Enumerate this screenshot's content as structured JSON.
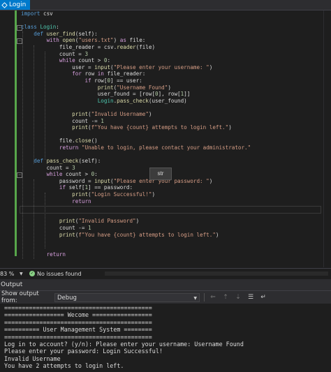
{
  "window": {
    "title": "Login"
  },
  "editor": {
    "tooltip": "str",
    "lines": [
      [
        [
          "import",
          "kw"
        ],
        [
          " csv",
          "id"
        ]
      ],
      [
        [
          "",
          ""
        ]
      ],
      [
        [
          "class",
          "kw"
        ],
        [
          " ",
          ""
        ],
        [
          "Login",
          "cls"
        ],
        [
          ":",
          "id"
        ]
      ],
      [
        [
          "    ",
          ""
        ],
        [
          "def",
          "kw"
        ],
        [
          " ",
          ""
        ],
        [
          "user_find",
          "fn"
        ],
        [
          "(self):",
          "id"
        ]
      ],
      [
        [
          "        ",
          ""
        ],
        [
          "with",
          "ctl"
        ],
        [
          " ",
          ""
        ],
        [
          "open",
          "fn"
        ],
        [
          "(",
          "id"
        ],
        [
          "\"users.txt\"",
          "str"
        ],
        [
          ") ",
          "id"
        ],
        [
          "as",
          "ctl"
        ],
        [
          " file:",
          "id"
        ]
      ],
      [
        [
          "            file_reader = csv.",
          ""
        ],
        [
          "reader",
          "fn"
        ],
        [
          "(file)",
          "id"
        ]
      ],
      [
        [
          "            count = ",
          ""
        ],
        [
          "3",
          "num"
        ]
      ],
      [
        [
          "            ",
          ""
        ],
        [
          "while",
          "ctl"
        ],
        [
          " count > ",
          ""
        ],
        [
          "0",
          "num"
        ],
        [
          ":",
          "id"
        ]
      ],
      [
        [
          "                user = ",
          ""
        ],
        [
          "input",
          "fn"
        ],
        [
          "(",
          "id"
        ],
        [
          "\"Please enter your username: \"",
          "str"
        ],
        [
          ")",
          "id"
        ]
      ],
      [
        [
          "                ",
          ""
        ],
        [
          "for",
          "ctl"
        ],
        [
          " row ",
          ""
        ],
        [
          "in",
          "ctl"
        ],
        [
          " file_reader:",
          "id"
        ]
      ],
      [
        [
          "                    ",
          ""
        ],
        [
          "if",
          "ctl"
        ],
        [
          " row[",
          ""
        ],
        [
          "0",
          "num"
        ],
        [
          "] == user:",
          "id"
        ]
      ],
      [
        [
          "                        ",
          ""
        ],
        [
          "print",
          "fn"
        ],
        [
          "(",
          "id"
        ],
        [
          "\"Username Found\"",
          "str"
        ],
        [
          ")",
          "id"
        ]
      ],
      [
        [
          "                        user_found = [row[",
          ""
        ],
        [
          "0",
          "num"
        ],
        [
          "], row[",
          "id"
        ],
        [
          "1",
          "num"
        ],
        [
          "]]",
          "id"
        ]
      ],
      [
        [
          "                        ",
          ""
        ],
        [
          "Login",
          "cls"
        ],
        [
          ".",
          "id"
        ],
        [
          "pass_check",
          "fn"
        ],
        [
          "(user_found)",
          "id"
        ]
      ],
      [
        [
          "",
          ""
        ]
      ],
      [
        [
          "                ",
          ""
        ],
        [
          "print",
          "fn"
        ],
        [
          "(",
          "id"
        ],
        [
          "\"Invalid Username\"",
          "str"
        ],
        [
          ")",
          "id"
        ]
      ],
      [
        [
          "                count -= ",
          ""
        ],
        [
          "1",
          "num"
        ]
      ],
      [
        [
          "                ",
          ""
        ],
        [
          "print",
          "fn"
        ],
        [
          "(",
          "id"
        ],
        [
          "f\"You have {count} attempts to login left.\"",
          "str"
        ],
        [
          ")",
          "id"
        ]
      ],
      [
        [
          "",
          ""
        ]
      ],
      [
        [
          "            file.",
          ""
        ],
        [
          "close",
          "fn"
        ],
        [
          "()",
          "id"
        ]
      ],
      [
        [
          "            ",
          ""
        ],
        [
          "return",
          "ctl"
        ],
        [
          " ",
          ""
        ],
        [
          "\"Unable to login, please contact your administrator.\"",
          "str"
        ]
      ],
      [
        [
          "",
          ""
        ]
      ],
      [
        [
          "    ",
          ""
        ],
        [
          "def",
          "kw"
        ],
        [
          " ",
          ""
        ],
        [
          "pass_check",
          "fn"
        ],
        [
          "(self):",
          "id"
        ]
      ],
      [
        [
          "        count = ",
          ""
        ],
        [
          "3",
          "num"
        ]
      ],
      [
        [
          "        ",
          ""
        ],
        [
          "while",
          "ctl"
        ],
        [
          " count > ",
          ""
        ],
        [
          "0",
          "num"
        ],
        [
          ":",
          "id"
        ]
      ],
      [
        [
          "            password = ",
          ""
        ],
        [
          "input",
          "fn"
        ],
        [
          "(",
          "id"
        ],
        [
          "\"Please enter your password: \"",
          "str"
        ],
        [
          ")",
          "id"
        ]
      ],
      [
        [
          "            ",
          ""
        ],
        [
          "if",
          "ctl"
        ],
        [
          " self[",
          ""
        ],
        [
          "1",
          "num"
        ],
        [
          "] == password:",
          "id"
        ]
      ],
      [
        [
          "                ",
          ""
        ],
        [
          "print",
          "fn"
        ],
        [
          "(",
          "id"
        ],
        [
          "\"Login Successful!\"",
          "str"
        ],
        [
          ")",
          "id"
        ]
      ],
      [
        [
          "                ",
          ""
        ],
        [
          "return",
          "ctl"
        ]
      ],
      [
        [
          "",
          ""
        ]
      ],
      [
        [
          "",
          ""
        ]
      ],
      [
        [
          "            ",
          ""
        ],
        [
          "print",
          "fn"
        ],
        [
          "(",
          "id"
        ],
        [
          "\"Invalid Password\"",
          "str"
        ],
        [
          ")",
          "id"
        ]
      ],
      [
        [
          "            count -= ",
          ""
        ],
        [
          "1",
          "num"
        ]
      ],
      [
        [
          "            ",
          ""
        ],
        [
          "print",
          "fn"
        ],
        [
          "(",
          "id"
        ],
        [
          "f\"You have {count} attempts to login left.\"",
          "str"
        ],
        [
          ")",
          "id"
        ]
      ],
      [
        [
          "",
          ""
        ]
      ],
      [
        [
          "",
          ""
        ]
      ],
      [
        [
          "        ",
          ""
        ],
        [
          "return",
          "ctl"
        ]
      ]
    ]
  },
  "status": {
    "zoom": "83 %",
    "issues": "No issues found"
  },
  "output": {
    "header": "Output",
    "show_from_label": "Show output from:",
    "source": "Debug",
    "lines": [
      "==========================================",
      "================= Wecome =================",
      "==========================================",
      "========== User Management System ========",
      "==========================================",
      "Log in to account? (y/n): Please enter your username: Username Found",
      "Please enter your password: Login Successful!",
      "Invalid Username",
      "You have 2 attempts to login left."
    ]
  },
  "colors": {
    "accent": "#007acc",
    "background": "#1e1e1e",
    "ok": "#89d185"
  }
}
